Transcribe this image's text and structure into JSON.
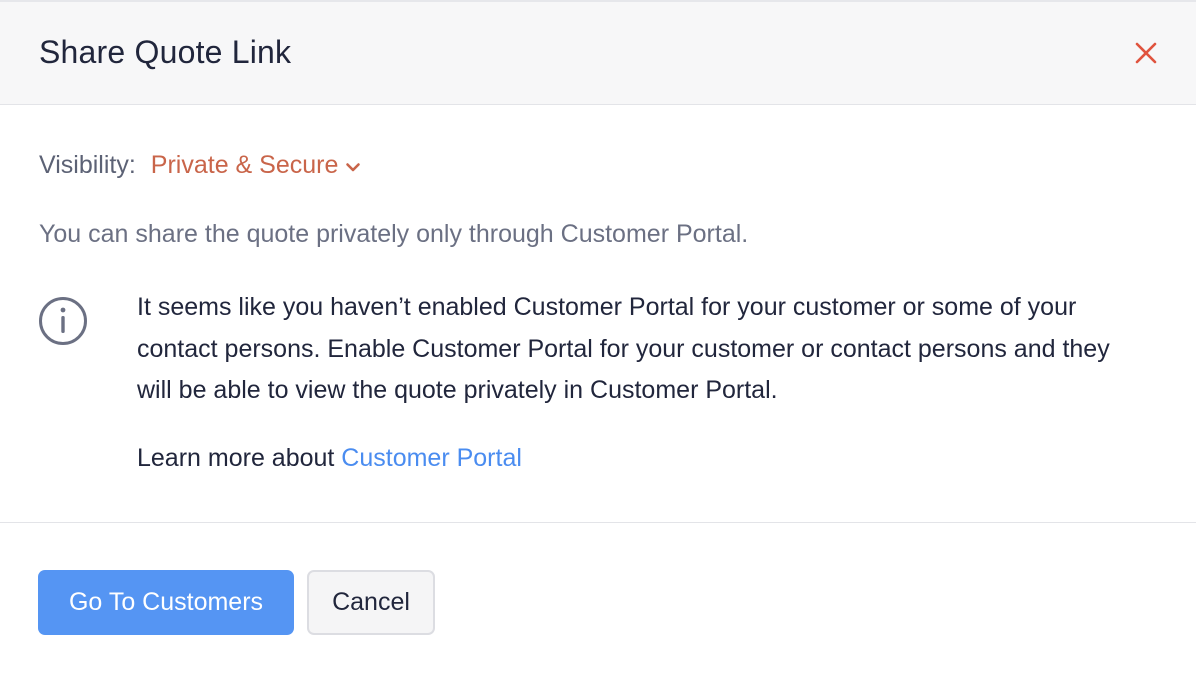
{
  "dialog": {
    "title": "Share Quote Link",
    "close_icon": "close-icon"
  },
  "visibility": {
    "label": "Visibility:",
    "value": "Private & Secure",
    "chevron_icon": "chevron-down-icon"
  },
  "description": "You can share the quote privately only through Customer Portal.",
  "info": {
    "icon": "info-icon",
    "message": "It seems like you haven’t enabled Customer Portal for your customer or some of your contact persons. Enable Customer Portal for your customer or contact persons and they will be able to view the quote privately in Customer Portal.",
    "learn_prefix": "Learn more about ",
    "learn_link": "Customer Portal"
  },
  "footer": {
    "primary_label": "Go To Customers",
    "secondary_label": "Cancel"
  },
  "colors": {
    "accent_blue": "#5595f3",
    "link_blue": "#4a8cf0",
    "visibility_orange": "#c9654a",
    "close_red": "#e0533e"
  }
}
